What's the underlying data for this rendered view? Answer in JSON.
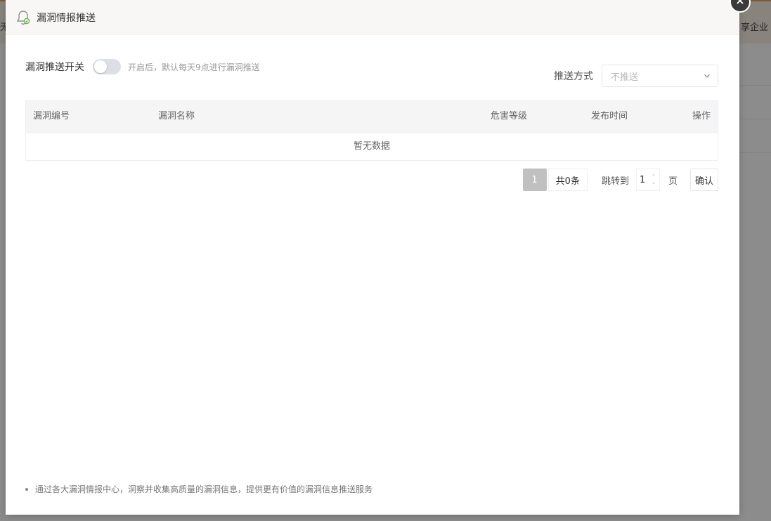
{
  "background": {
    "link_text": "享企业",
    "left_char": "无"
  },
  "modal": {
    "title": "漏洞情报推送",
    "close_icon": "close-icon"
  },
  "switch": {
    "label": "漏洞推送开关",
    "enabled": false,
    "hint": "开启后，默认每天9点进行漏洞推送"
  },
  "push": {
    "label": "推送方式",
    "select_placeholder": "不推送"
  },
  "table": {
    "columns": [
      "漏洞编号",
      "漏洞名称",
      "危害等级",
      "发布时间",
      "操作"
    ],
    "empty_text": "暂无数据"
  },
  "pagination": {
    "current_page": "1",
    "total_text": "共0条",
    "jump_label": "跳转到",
    "jump_value": "1",
    "page_unit": "页",
    "confirm_label": "确认"
  },
  "footnote": "通过各大漏洞情报中心，洞察并收集高质量的漏洞信息，提供更有价值的漏洞信息推送服务",
  "colors": {
    "header_bg": "#f8f7f5",
    "toggle_off": "#dcdfe6",
    "page_active": "#c0c0c0",
    "accent_strip": "#e8a35a"
  }
}
